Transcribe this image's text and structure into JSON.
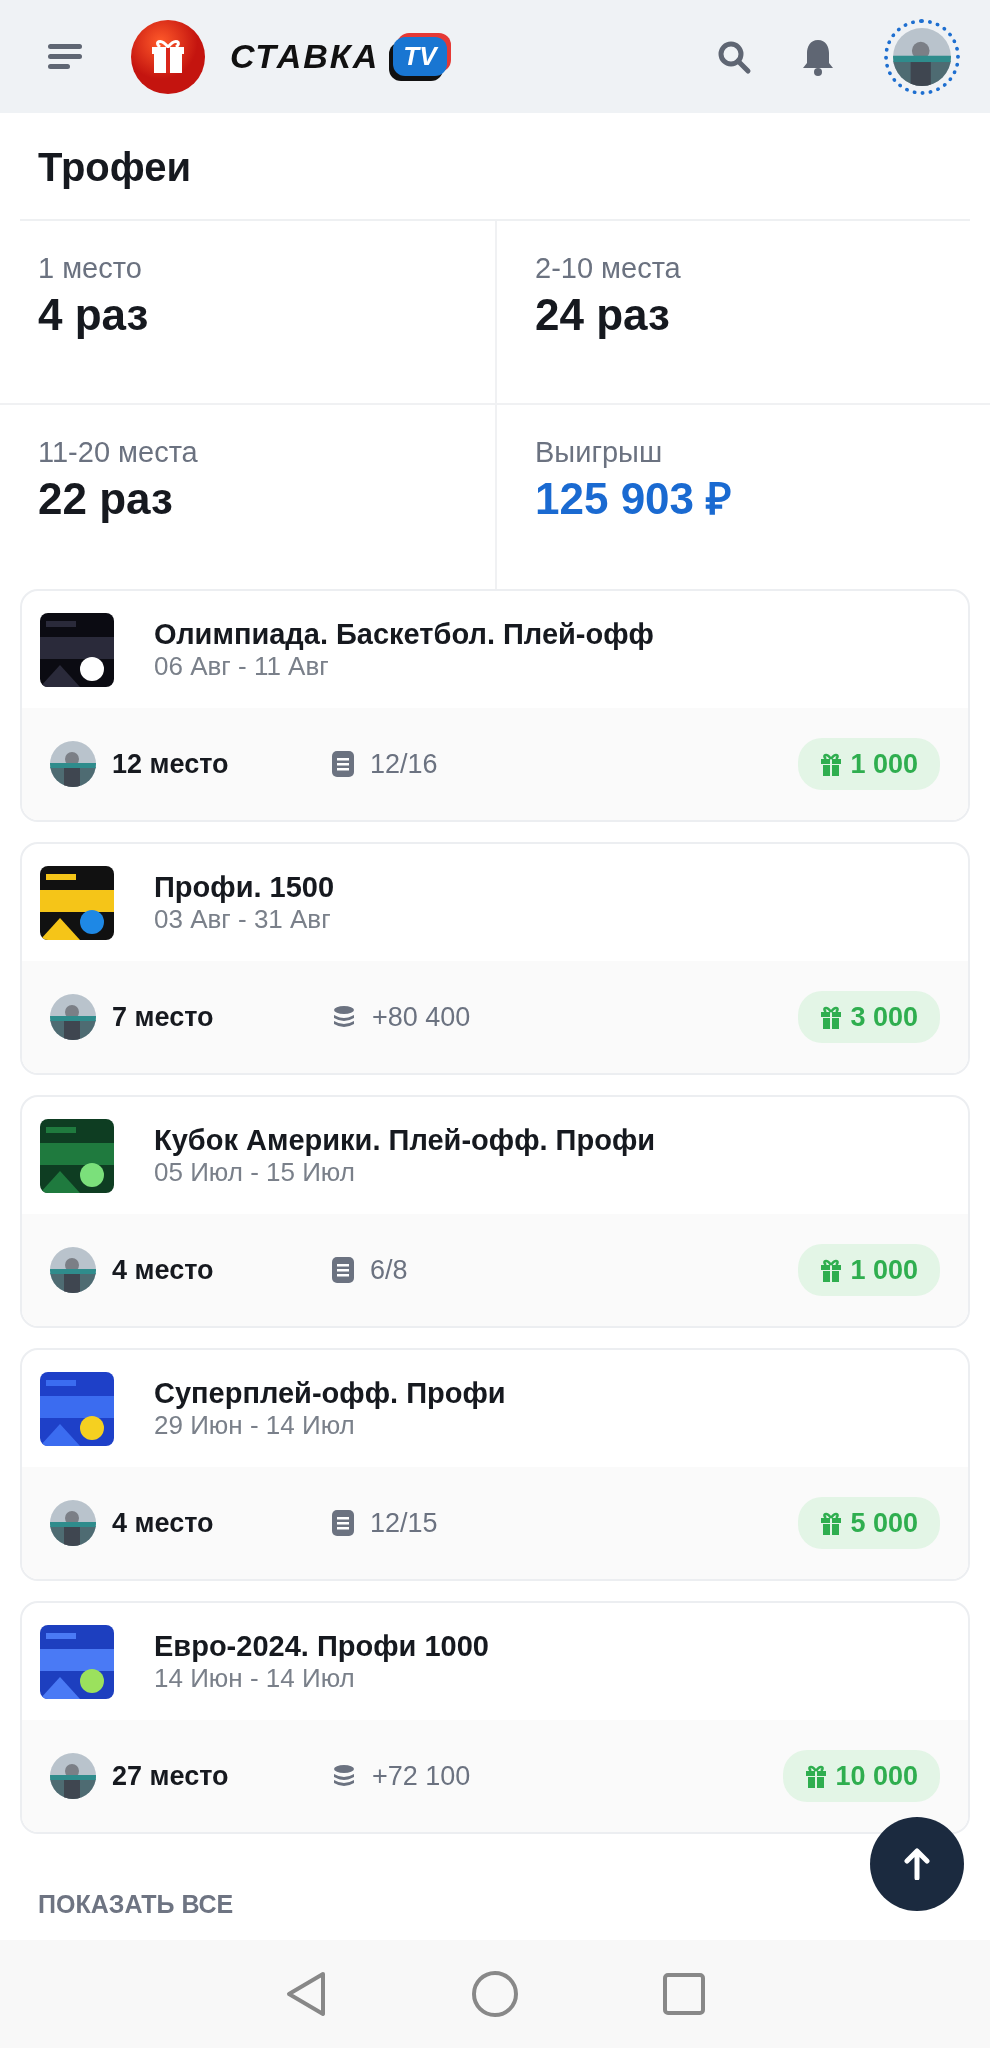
{
  "header": {
    "logo_text": "СТАВКА",
    "logo_badge": "TV"
  },
  "page": {
    "title": "Трофеи"
  },
  "stats": [
    {
      "label": "1 место",
      "value": "4 раз",
      "kind": "count"
    },
    {
      "label": "2-10 места",
      "value": "24 раз",
      "kind": "count"
    },
    {
      "label": "11-20 места",
      "value": "22 раз",
      "kind": "count"
    },
    {
      "label": "Выигрыш",
      "value": "125 903 ₽",
      "kind": "money"
    }
  ],
  "tournaments": [
    {
      "title": "Олимпиада. Баскетбол. Плей-офф",
      "dates": "06 Авг - 11 Авг",
      "place": "12 место",
      "score": {
        "kind": "tasks",
        "text": "12/16"
      },
      "prize": "1 000"
    },
    {
      "title": "Профи. 1500",
      "dates": "03 Авг - 31 Авг",
      "place": "7 место",
      "score": {
        "kind": "coins",
        "text": "+80 400"
      },
      "prize": "3 000"
    },
    {
      "title": "Кубок Америки. Плей-офф. Профи",
      "dates": "05 Июл - 15 Июл",
      "place": "4 место",
      "score": {
        "kind": "tasks",
        "text": "6/8"
      },
      "prize": "1 000"
    },
    {
      "title": "Суперплей-офф. Профи",
      "dates": "29 Июн - 14 Июл",
      "place": "4 место",
      "score": {
        "kind": "tasks",
        "text": "12/15"
      },
      "prize": "5 000"
    },
    {
      "title": "Евро-2024. Профи 1000",
      "dates": "14 Июн - 14 Июл",
      "place": "27 место",
      "score": {
        "kind": "coins",
        "text": "+72 100"
      },
      "prize": "10 000"
    }
  ],
  "show_all": "ПОКАЗАТЬ ВСЕ"
}
